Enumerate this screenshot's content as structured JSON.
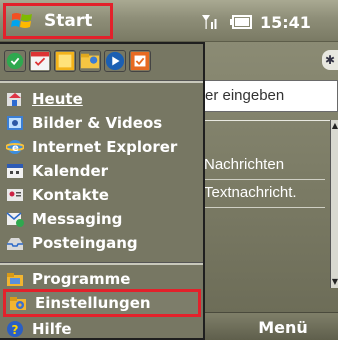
{
  "titlebar": {
    "start_label": "Start",
    "clock": "15:41",
    "icons": [
      "windows-flag-icon",
      "signal-icon",
      "battery-icon"
    ]
  },
  "background_app": {
    "search_placeholder": "er eingeben",
    "rows": [
      "Nachrichten",
      "Textnachricht."
    ],
    "icons": [
      "bluetooth-icon"
    ]
  },
  "softkeys": {
    "right": "Menü"
  },
  "start_menu": {
    "quick_icons": [
      "today-icon",
      "calendar-icon",
      "notes-icon",
      "explorer-icon",
      "media-icon",
      "tasks-icon"
    ],
    "items": [
      {
        "label": "Heute",
        "icon": "today-icon"
      },
      {
        "label": "Bilder & Videos",
        "icon": "pictures-icon"
      },
      {
        "label": "Internet Explorer",
        "icon": "internet-explorer-icon"
      },
      {
        "label": "Kalender",
        "icon": "calendar-icon"
      },
      {
        "label": "Kontakte",
        "icon": "contacts-icon"
      },
      {
        "label": "Messaging",
        "icon": "messaging-icon"
      },
      {
        "label": "Posteingang",
        "icon": "inbox-icon"
      },
      {
        "label": "Programme",
        "icon": "programs-folder-icon"
      },
      {
        "label": "Einstellungen",
        "icon": "settings-icon"
      },
      {
        "label": "Hilfe",
        "icon": "help-icon"
      }
    ]
  },
  "colors": {
    "highlight": "#e3212b",
    "menu_bg": "#777763"
  }
}
